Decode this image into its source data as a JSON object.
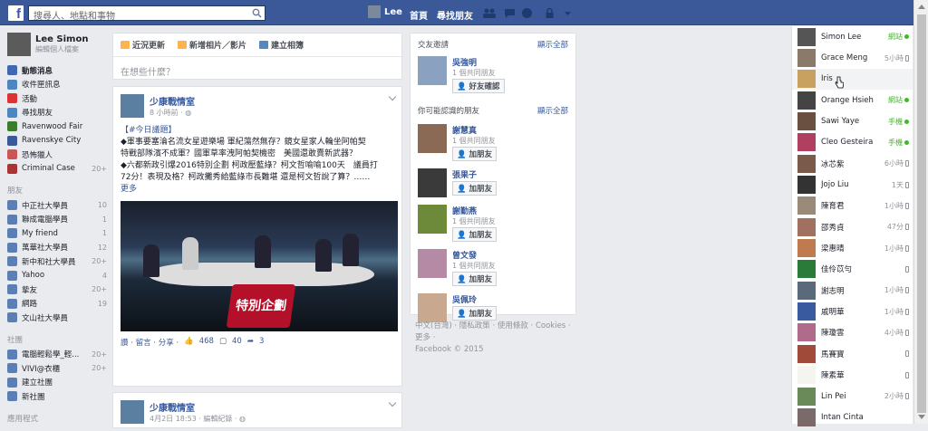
{
  "topbar": {
    "logo": "f",
    "search_placeholder": "搜尋人、地點和事物",
    "user_name": "Lee",
    "home": "首頁",
    "find_friends": "尋找朋友"
  },
  "profile": {
    "name": "Lee Simon",
    "edit": "編輯個人檔案"
  },
  "nav": [
    {
      "label": "動態消息",
      "count": "",
      "bold": true,
      "color": "#4267b2"
    },
    {
      "label": "收件匣訊息",
      "count": "",
      "color": "#4e86c2"
    },
    {
      "label": "活動",
      "count": "",
      "color": "#d33"
    },
    {
      "label": "尋找朋友",
      "count": "",
      "color": "#4e86c2"
    },
    {
      "label": "Ravenwood Fair",
      "count": "",
      "color": "#3a7d2a"
    },
    {
      "label": "Ravenskye City",
      "count": "",
      "color": "#3b5998"
    },
    {
      "label": "恐怖獵人",
      "count": "",
      "color": "#c55"
    },
    {
      "label": "Criminal Case",
      "count": "20+",
      "color": "#a33"
    }
  ],
  "friends_section": "朋友",
  "friends_nav": [
    {
      "label": "中正社大學員",
      "count": "10"
    },
    {
      "label": "聯成電腦學員",
      "count": "1"
    },
    {
      "label": "My friend",
      "count": "1"
    },
    {
      "label": "萬華社大學員",
      "count": "12"
    },
    {
      "label": "新中和社大學員",
      "count": "20+"
    },
    {
      "label": "Yahoo",
      "count": "4"
    },
    {
      "label": "摯友",
      "count": "20+"
    },
    {
      "label": "網路",
      "count": "19"
    },
    {
      "label": "文山社大學員",
      "count": ""
    }
  ],
  "groups_section": "社團",
  "groups_nav": [
    {
      "label": "電腦輕鬆學_輕...",
      "count": "20+"
    },
    {
      "label": "VIVI@衣櫃",
      "count": "20+"
    },
    {
      "label": "建立社團",
      "count": ""
    },
    {
      "label": "新社團",
      "count": ""
    }
  ],
  "apps_section": "應用程式",
  "composer": {
    "tab_status": "近況更新",
    "tab_photo": "新增相片／影片",
    "tab_album": "建立相簿",
    "placeholder": "在想些什麼？"
  },
  "post1": {
    "page": "少康戰情室",
    "time": "8 小時前 · ",
    "tag": "【#今日議題】",
    "line1": "◆軍事要塞淪名流女星遊樂場 軍紀蕩然無存？鏡女星家人輪坐阿帕契",
    "line2": "特戰部隊濱不成軍？國軍草率洩阿帕契機密　美國還敢賣新武器？",
    "line3": "◆六都新政引爆2016特別企劃 柯政壓藍綠？柯文哲喻喻100天　議員打",
    "line4": "72分！表現及格？柯政攤秀給藍綠市長難堪 還是柯文哲說了算？……",
    "more": "更多",
    "banner": "特別企劃",
    "actions": "讚 · 留言 · 分享 · ",
    "likes": "468",
    "comments": "40",
    "shares": "3"
  },
  "post2": {
    "page": "少康戰情室",
    "time": "4月2日 18:53 · 編輯紀錄 · "
  },
  "requests": {
    "title": "交友邀請",
    "see_all": "顯示全部",
    "items": [
      {
        "name": "吳強明",
        "mutual": "1 個共同朋友",
        "btn": "好友確認"
      }
    ]
  },
  "pymk": {
    "title": "你可能認識的朋友",
    "see_all": "顯示全部",
    "items": [
      {
        "name": "謝慧真",
        "mutual": "1 個共同朋友",
        "btn": "加朋友",
        "color": "#8a6a55"
      },
      {
        "name": "張果子",
        "mutual": "",
        "btn": "加朋友",
        "color": "#3a3a3a"
      },
      {
        "name": "謝勤燕",
        "mutual": "1 個共同朋友",
        "btn": "加朋友",
        "color": "#6c8a3a"
      },
      {
        "name": "曾文發",
        "mutual": "1 個共同朋友",
        "btn": "加朋友",
        "color": "#b58aa5"
      },
      {
        "name": "吳佩玲",
        "mutual": "",
        "btn": "加朋友",
        "color": "#c9a890"
      }
    ]
  },
  "footer": {
    "line1": "中文(台灣) · 隱私政策 · 使用條款 · Cookies ·",
    "line2": "更多 ·",
    "line3": "Facebook © 2015"
  },
  "chat": [
    {
      "name": "Simon Lee",
      "status": "網站",
      "kind": "web",
      "color": "#555"
    },
    {
      "name": "Grace Meng",
      "status": "5小時",
      "kind": "phone",
      "color": "#8a7a6a"
    },
    {
      "name": "Iris",
      "status": "",
      "kind": "none",
      "color": "#c8a060"
    },
    {
      "name": "Orange Hsieh",
      "status": "網站",
      "kind": "web",
      "color": "#444"
    },
    {
      "name": "Sawi Yaye",
      "status": "手機",
      "kind": "mobile",
      "color": "#6a5040"
    },
    {
      "name": "Cleo Gesteira",
      "status": "手機",
      "kind": "mobile",
      "color": "#b04060"
    },
    {
      "name": "冰芯紫",
      "status": "6小時",
      "kind": "phone",
      "color": "#7a5a4a"
    },
    {
      "name": "Jojo Liu",
      "status": "1天",
      "kind": "phone",
      "color": "#333"
    },
    {
      "name": "陳育君",
      "status": "1小時",
      "kind": "phone",
      "color": "#9a8a7a"
    },
    {
      "name": "邵秀貞",
      "status": "47分",
      "kind": "phone",
      "color": "#a07060"
    },
    {
      "name": "梁惠晴",
      "status": "1小時",
      "kind": "phone",
      "color": "#c07a50"
    },
    {
      "name": "佳伶苡勻",
      "status": "",
      "kind": "phone",
      "color": "#2a7a3a"
    },
    {
      "name": "謝志明",
      "status": "1小時",
      "kind": "phone",
      "color": "#5a6a7a"
    },
    {
      "name": "戚明華",
      "status": "1小時",
      "kind": "phone",
      "color": "#3a5aa0"
    },
    {
      "name": "陳瓊雲",
      "status": "4小時",
      "kind": "phone",
      "color": "#b06a8a"
    },
    {
      "name": "馬賽寶",
      "status": "",
      "kind": "phone",
      "color": "#a04a3a"
    },
    {
      "name": "陳素華",
      "status": "",
      "kind": "phone",
      "color": "#f5f5f0"
    },
    {
      "name": "Lin Pei",
      "status": "2小時",
      "kind": "phone",
      "color": "#6a8a5a"
    },
    {
      "name": "Intan Cinta",
      "status": "",
      "kind": "none",
      "color": "#7a6a6a"
    }
  ]
}
